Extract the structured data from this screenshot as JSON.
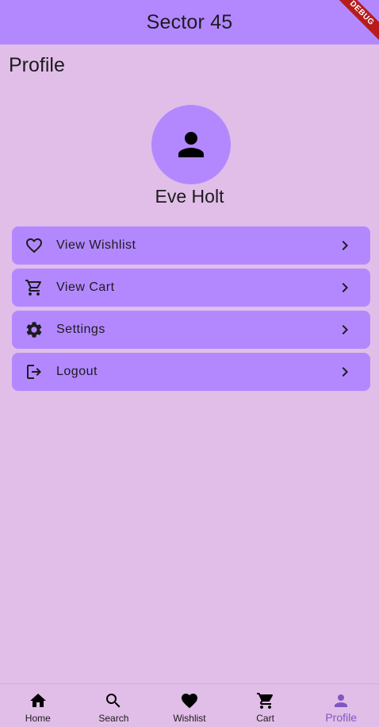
{
  "app_bar": {
    "title": "Sector 45",
    "debug_label": "DEBUG"
  },
  "page": {
    "title": "Profile"
  },
  "profile": {
    "name": "Eve Holt",
    "avatar_icon": "person-icon",
    "avatar_color": "#b388ff"
  },
  "menu": {
    "items": [
      {
        "label": "View Wishlist",
        "icon": "heart-outline-icon"
      },
      {
        "label": "View Cart",
        "icon": "cart-outline-icon"
      },
      {
        "label": "Settings",
        "icon": "gear-icon"
      },
      {
        "label": "Logout",
        "icon": "logout-icon"
      }
    ]
  },
  "bottom_nav": {
    "items": [
      {
        "label": "Home",
        "icon": "home-icon"
      },
      {
        "label": "Search",
        "icon": "search-icon"
      },
      {
        "label": "Wishlist",
        "icon": "heart-icon"
      },
      {
        "label": "Cart",
        "icon": "cart-icon"
      },
      {
        "label": "Profile",
        "icon": "person-icon"
      }
    ],
    "selected": "Profile"
  },
  "colors": {
    "background": "#e1bee7",
    "accent": "#b388ff",
    "selected_nav": "#7e57c2",
    "debug_banner": "#b71c1c"
  }
}
